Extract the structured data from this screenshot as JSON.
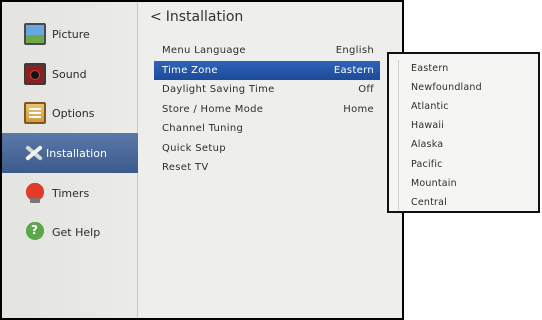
{
  "sidebar": {
    "items": [
      {
        "label": "Picture",
        "icon": "picture-icon"
      },
      {
        "label": "Sound",
        "icon": "speaker-icon"
      },
      {
        "label": "Options",
        "icon": "options-icon"
      },
      {
        "label": "Installation",
        "icon": "tools-icon",
        "active": true
      },
      {
        "label": "Timers",
        "icon": "timer-icon"
      },
      {
        "label": "Get Help",
        "icon": "help-icon"
      }
    ]
  },
  "header": {
    "back_glyph": "<",
    "title": "Installation"
  },
  "menu": {
    "rows": [
      {
        "label": "Menu Language",
        "value": "English"
      },
      {
        "label": "Time Zone",
        "value": "Eastern",
        "selected": true
      },
      {
        "label": "Daylight Saving Time",
        "value": "Off"
      },
      {
        "label": "Store / Home Mode",
        "value": "Home"
      },
      {
        "label": "Channel Tuning",
        "value": ""
      },
      {
        "label": "Quick Setup",
        "value": ""
      },
      {
        "label": "Reset TV",
        "value": ""
      }
    ]
  },
  "timezone_popup": {
    "options": [
      "Eastern",
      "Newfoundland",
      "Atlantic",
      "Hawaii",
      "Alaska",
      "Pacific",
      "Mountain",
      "Central"
    ]
  },
  "colors": {
    "sidebar_active": "#3c5a8c",
    "row_selected": "#1d4a99",
    "screen_bg": "#eeeeec"
  }
}
